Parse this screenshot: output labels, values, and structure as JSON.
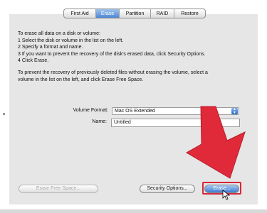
{
  "tabs": [
    {
      "label": "First Aid"
    },
    {
      "label": "Erase",
      "active": true
    },
    {
      "label": "Partition"
    },
    {
      "label": "RAID"
    },
    {
      "label": "Restore"
    }
  ],
  "instructions": {
    "lines": [
      "To erase all data on a disk or volume:",
      "1 Select the disk or volume in the list on the left.",
      "2 Specify a format and name.",
      "3 If you want to prevent the recovery of the disk's erased data, click Security Options.",
      "4 Click Erase."
    ],
    "paragraph_line1": "To prevent the recovery of previously deleted files without erasing the volume, select a",
    "paragraph_line2": "volume in the list on the left, and click Erase Free Space."
  },
  "form": {
    "format_label": "Volume Format:",
    "format_value": "Mac OS Extended",
    "name_label": "Name:",
    "name_value": "Untitled"
  },
  "buttons": {
    "erase_free_space": "Erase Free Space...",
    "security_options": "Security Options...",
    "erase": "Erase..."
  },
  "annotation": {
    "arrow_color": "#e02a3a",
    "highlight_color": "#d7263d"
  },
  "icons": {
    "select_arrows": "up-down-chevron"
  }
}
